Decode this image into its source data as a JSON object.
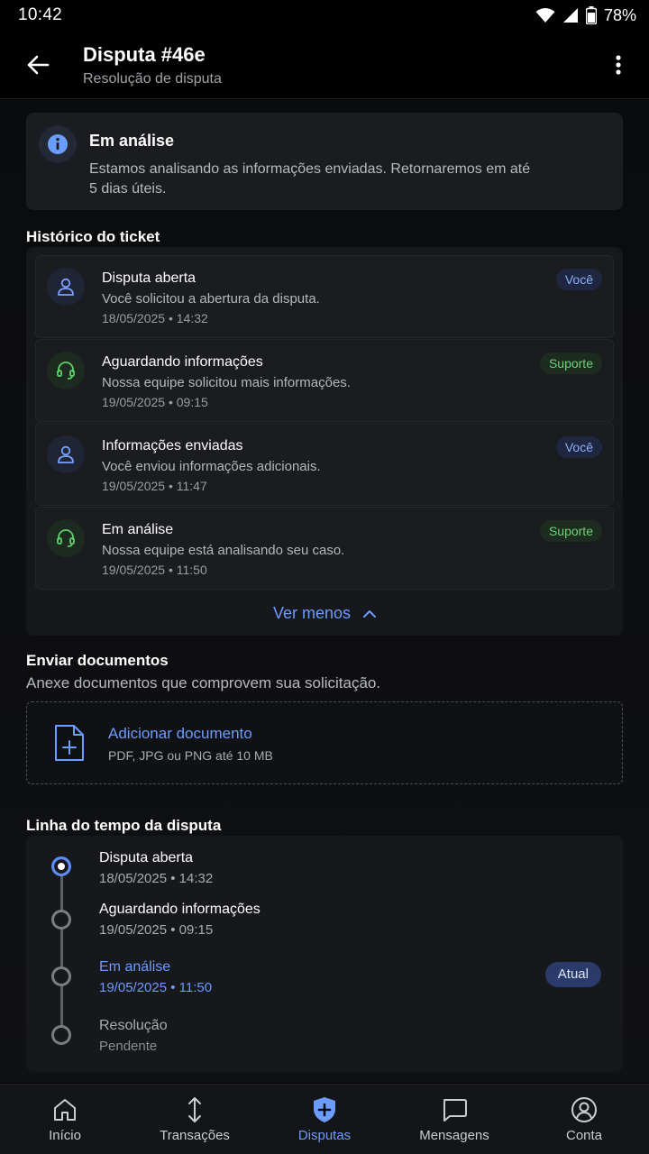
{
  "status_bar": {
    "time": "10:42",
    "battery": "78%"
  },
  "header": {
    "title": "Disputa #46e",
    "subtitle": "Resolução de disputa"
  },
  "status_card": {
    "title": "Em análise",
    "description": "Estamos analisando as informações enviadas. Retornaremos em até 5 dias úteis."
  },
  "history": {
    "title": "Histórico do ticket",
    "items": [
      {
        "title": "Disputa aberta",
        "description": "Você solicitou a abertura da disputa.",
        "date": "18/05/2025 • 14:32",
        "badge": "Você",
        "icon": "user-icon"
      },
      {
        "title": "Aguardando informações",
        "description": "Nossa equipe solicitou mais informações.",
        "date": "19/05/2025 • 09:15",
        "badge": "Suporte",
        "icon": "headset-icon"
      },
      {
        "title": "Informações enviadas",
        "description": "Você enviou informações adicionais.",
        "date": "19/05/2025 • 11:47",
        "badge": "Você",
        "icon": "user-icon"
      },
      {
        "title": "Em análise",
        "description": "Nossa equipe está analisando seu caso.",
        "date": "19/05/2025 • 11:50",
        "badge": "Suporte",
        "icon": "headset-icon"
      }
    ],
    "toggle_label": "Ver menos"
  },
  "upload": {
    "title": "Enviar documentos",
    "subtitle": "Anexe documentos que comprovem sua solicitação.",
    "button_label": "Adicionar documento",
    "hint": "PDF, JPG ou PNG até 10 MB"
  },
  "timeline": {
    "title": "Linha do tempo da disputa",
    "steps": [
      {
        "title": "Disputa aberta",
        "date": "18/05/2025 • 14:32"
      },
      {
        "title": "Aguardando informações",
        "date": "19/05/2025 • 09:15"
      },
      {
        "title": "Em análise",
        "date": "19/05/2025 • 11:50"
      },
      {
        "title": "Resolução",
        "date": "Pendente"
      }
    ],
    "current_badge": "Atual"
  },
  "nav": {
    "items": [
      {
        "label": "Início",
        "icon": "home-icon"
      },
      {
        "label": "Transações",
        "icon": "transfer-icon"
      },
      {
        "label": "Disputas",
        "icon": "shield-plus-icon"
      },
      {
        "label": "Mensagens",
        "icon": "chat-icon"
      },
      {
        "label": "Conta",
        "icon": "account-icon"
      }
    ]
  },
  "colors": {
    "accent": "#6b9cff",
    "support": "#6fd27a",
    "background": "#000000"
  }
}
